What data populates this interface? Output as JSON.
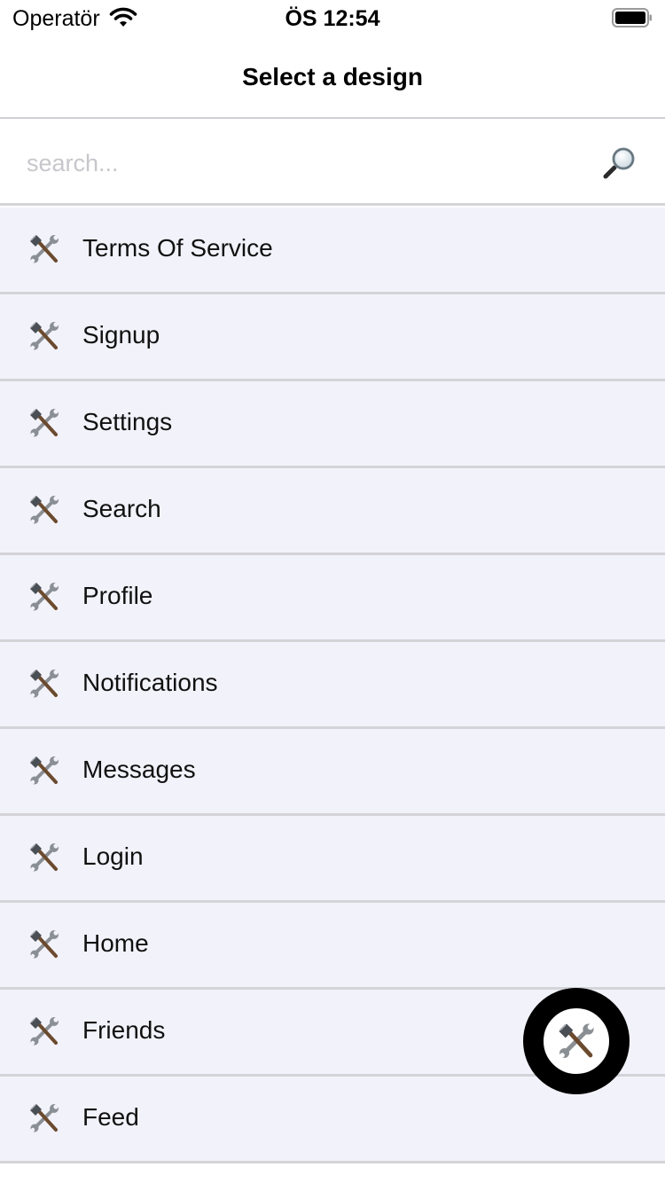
{
  "status_bar": {
    "carrier": "Operatör",
    "time": "ÖS 12:54",
    "icons": [
      "wifi-icon",
      "battery-icon"
    ]
  },
  "nav": {
    "title": "Select a design"
  },
  "search": {
    "placeholder": "search...",
    "value": "",
    "icon": "magnifying-glass-icon"
  },
  "list": {
    "item_icon": "hammer-and-wrench-icon",
    "items": [
      "Terms Of Service",
      "Signup",
      "Settings",
      "Search",
      "Profile",
      "Notifications",
      "Messages",
      "Login",
      "Home",
      "Friends",
      "Feed"
    ]
  },
  "fab": {
    "icon": "hammer-and-wrench-icon"
  },
  "colors": {
    "list_background": "#f2f2fa",
    "separator": "#d4d4d8",
    "placeholder": "#c7c7cc",
    "fab_ring": "#000000"
  }
}
